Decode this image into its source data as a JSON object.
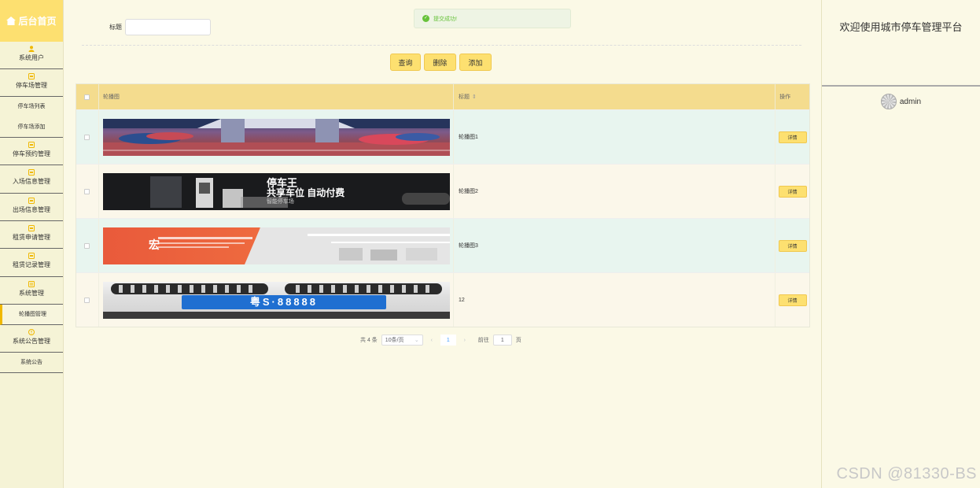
{
  "sidebar": {
    "brand": "后台首页",
    "items": [
      {
        "label": "系统用户",
        "icon": "user-icon"
      },
      {
        "label": "停车场管理",
        "icon": "folder-icon"
      },
      {
        "label": "停车场列表"
      },
      {
        "label": "停车场添加"
      },
      {
        "label": "停车预约管理",
        "icon": "folder-icon"
      },
      {
        "label": "入场信息管理",
        "icon": "folder-icon"
      },
      {
        "label": "出场信息管理",
        "icon": "folder-icon"
      },
      {
        "label": "租赁申请管理",
        "icon": "folder-icon"
      },
      {
        "label": "租赁记录管理",
        "icon": "folder-icon"
      },
      {
        "label": "系统管理",
        "icon": "document-icon"
      },
      {
        "label": "轮播图管理"
      },
      {
        "label": "系统公告管理",
        "icon": "info-icon"
      },
      {
        "label": "系统公告"
      }
    ]
  },
  "search": {
    "label": "标题",
    "value": ""
  },
  "toast": {
    "text": "提交成功!"
  },
  "buttons": {
    "query": "查询",
    "delete": "删除",
    "add": "添加"
  },
  "table": {
    "headers": {
      "image": "轮播图",
      "title": "标题",
      "title_sort": "⇕",
      "actions": "操作"
    },
    "rows": [
      {
        "title": "轮播图1",
        "action": "详情"
      },
      {
        "title": "轮播图2",
        "action": "详情"
      },
      {
        "title": "轮播图3",
        "action": "详情"
      },
      {
        "title": "12",
        "action": "详情"
      }
    ]
  },
  "pagination": {
    "total": "共 4 条",
    "page_size": "10条/页",
    "prev": "‹",
    "current": "1",
    "next": "›",
    "goto_prefix": "前往",
    "goto_value": "1",
    "goto_suffix": "页"
  },
  "right_panel": {
    "welcome": "欢迎使用城市停车管理平台",
    "username": "admin"
  },
  "watermark": "CSDN @81330-BS",
  "banner2": {
    "line1": "停车王",
    "line2": "共享车位 自动付费",
    "line3": "智能停车场"
  },
  "banner3": {
    "text": "宏"
  },
  "banner4": {
    "plate": "粤S·88888"
  },
  "colors": {
    "accent": "#fde070",
    "success": "#67c23a",
    "header": "#f4dc8e",
    "row_alt": "#e8f5ef"
  }
}
